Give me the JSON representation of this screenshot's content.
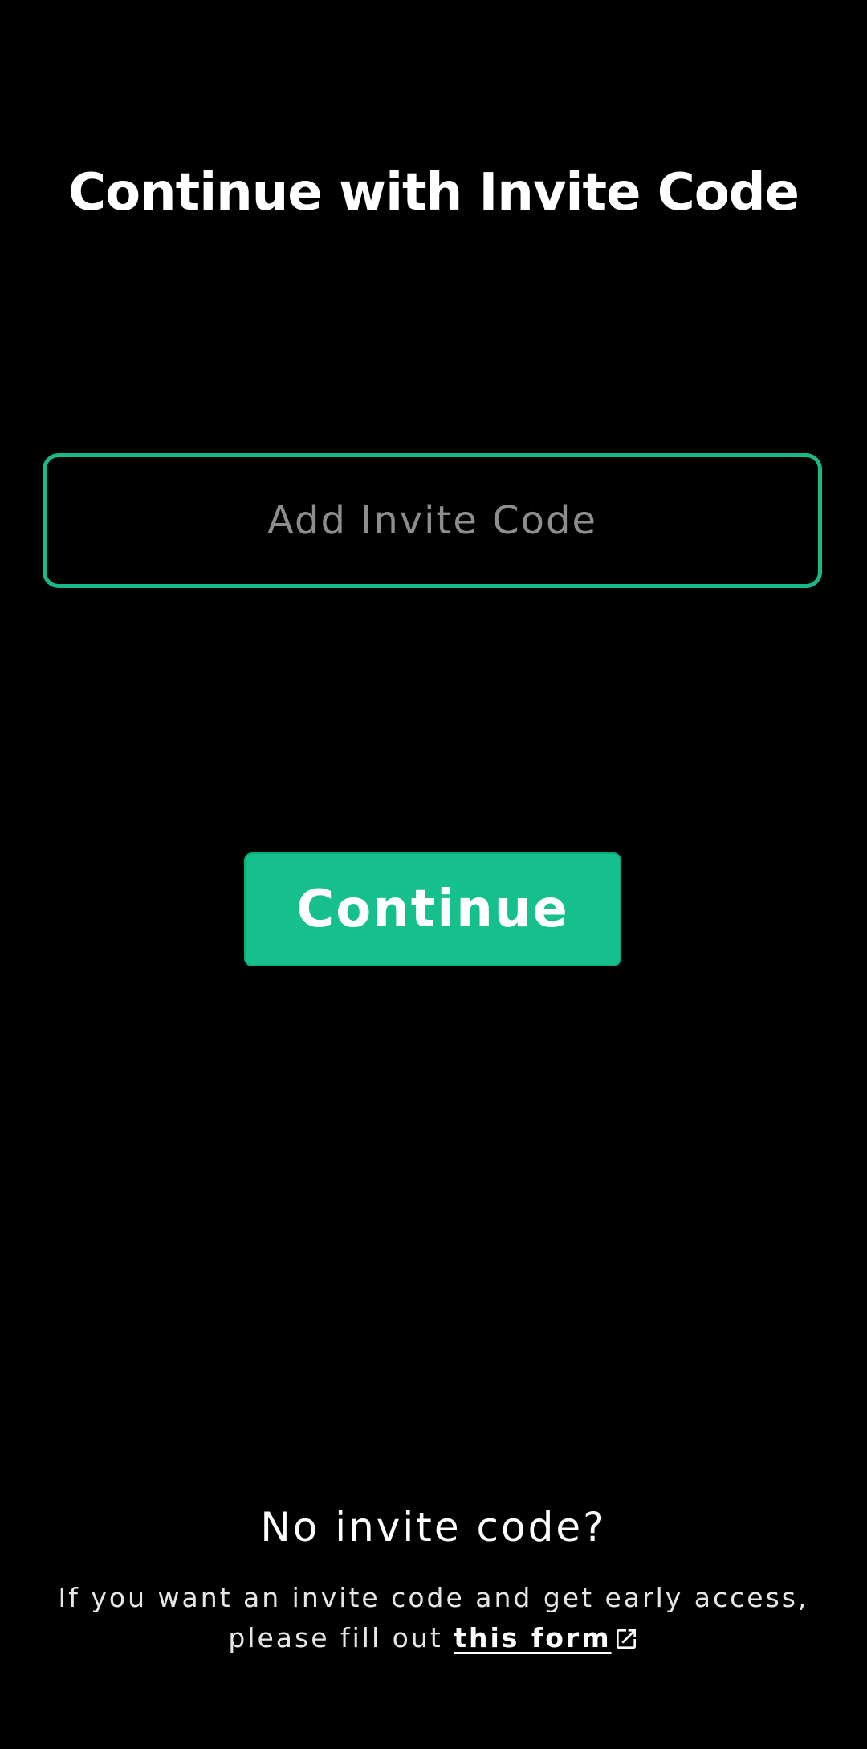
{
  "page": {
    "title": "Continue with Invite Code"
  },
  "invite_input": {
    "value": "",
    "placeholder": "Add Invite Code"
  },
  "continue_button": {
    "label": "Continue"
  },
  "no_code": {
    "heading": "No invite code?",
    "line1": "If you want an invite code and get early access,",
    "line2_prefix": "please fill out",
    "link_text": "this form",
    "link_icon": "external-link-icon"
  },
  "colors": {
    "background": "#000000",
    "accent": "#16c08d",
    "input_border": "#19b888",
    "placeholder": "#8d8d8d",
    "text": "#ffffff"
  }
}
